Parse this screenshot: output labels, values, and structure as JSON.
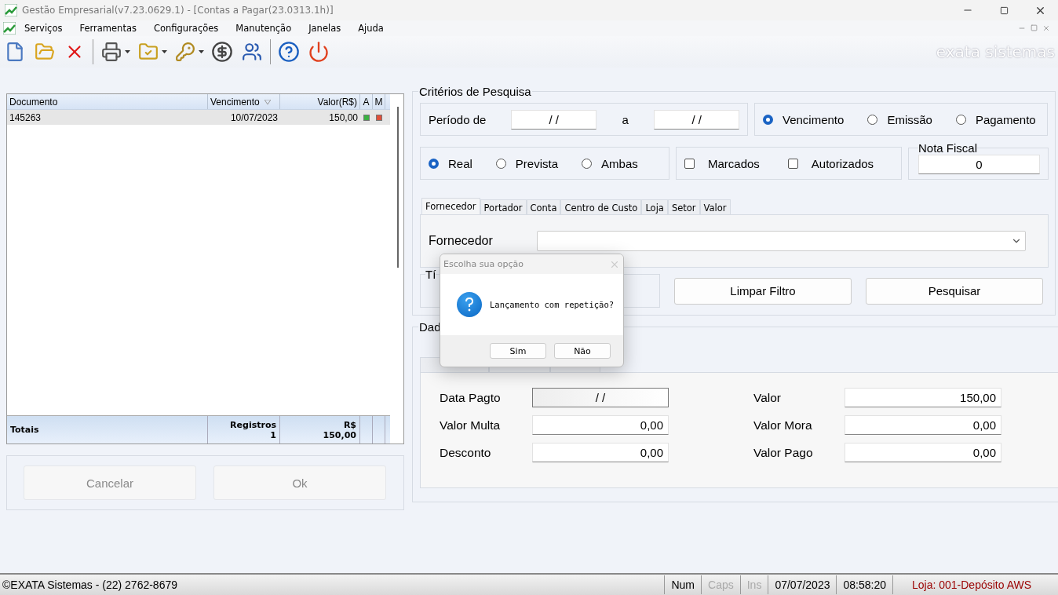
{
  "window": {
    "title": "Gestão Empresarial(v7.23.0629.1) - [Contas a Pagar(23.0313.1h)]"
  },
  "menu": [
    "Serviços",
    "Ferramentas",
    "Configurações",
    "Manutenção",
    "Janelas",
    "Ajuda"
  ],
  "brand": "exata sistemas",
  "grid": {
    "columns": [
      {
        "label": "Documento",
        "sorted": false
      },
      {
        "label": "Vencimento",
        "sorted": true
      },
      {
        "label": "Valor(R$)",
        "sorted": false
      },
      {
        "label": "A",
        "sorted": false
      },
      {
        "label": "M",
        "sorted": false
      }
    ],
    "rows": [
      {
        "documento": "145263",
        "vencimento": "10/07/2023",
        "valor": "150,00",
        "a": {
          "color": "#3cb043"
        },
        "m": {
          "color": "#e0503a"
        },
        "selected": true
      }
    ],
    "totals": {
      "label": "Totais",
      "count_label": "Registros",
      "count": "1",
      "sum_label": "R$",
      "sum": "150,00"
    }
  },
  "actions": [
    {
      "label": "Cancelar",
      "disabled": true
    },
    {
      "label": "Ok",
      "disabled": true
    }
  ],
  "criteria": {
    "title": "Critérios de Pesquisa",
    "period_label": "Período de",
    "from": "/ /",
    "to_label": "a",
    "to": "/ /",
    "date_types": [
      {
        "label": "Vencimento",
        "selected": true
      },
      {
        "label": "Emissão",
        "selected": false
      },
      {
        "label": "Pagamento",
        "selected": false
      }
    ],
    "launch_types": [
      {
        "label": "Real",
        "selected": true
      },
      {
        "label": "Prevista",
        "selected": false
      },
      {
        "label": "Ambas",
        "selected": false
      }
    ],
    "flags": [
      {
        "label": "Marcados",
        "checked": false
      },
      {
        "label": "Autorizados",
        "checked": false
      }
    ],
    "nota_fiscal": {
      "title": "Nota Fiscal",
      "value": "0"
    },
    "tabs": [
      {
        "label": "Fornecedor",
        "selected": true
      },
      {
        "label": "Portador",
        "selected": false
      },
      {
        "label": "Conta",
        "selected": false
      },
      {
        "label": "Centro de Custo",
        "selected": false
      },
      {
        "label": "Loja",
        "selected": false
      },
      {
        "label": "Setor",
        "selected": false
      },
      {
        "label": "Valor",
        "selected": false
      }
    ],
    "filter_label": "Fornecedor",
    "type_group": {
      "title": "Tí"
    },
    "buttons": [
      "Limpar Filtro",
      "Pesquisar"
    ]
  },
  "details": {
    "title": "Dad",
    "left": [
      {
        "label": "Data Pagto",
        "value": "/ /",
        "focused": true
      },
      {
        "label": "Valor Multa",
        "value": "0,00",
        "focused": false
      },
      {
        "label": "Desconto",
        "value": "0,00",
        "focused": false
      }
    ],
    "right": [
      {
        "label": "Valor",
        "value": "150,00",
        "focused": false
      },
      {
        "label": "Valor Mora",
        "value": "0,00",
        "focused": false
      },
      {
        "label": "Valor Pago",
        "value": "0,00",
        "focused": false
      }
    ]
  },
  "status_bar": {
    "copyright": "©EXATA Sistemas - (22) 2762-8679",
    "indicators": [
      {
        "label": "Num",
        "on": true
      },
      {
        "label": "Caps",
        "on": false
      },
      {
        "label": "Ins",
        "on": false
      }
    ],
    "date": "07/07/2023",
    "time": "08:58:20",
    "store": "Loja: 001-Depósito AWS"
  },
  "dialog": {
    "title": "Escolha sua opção",
    "message": "Lançamento com repetição?",
    "buttons": [
      "Sim",
      "Não"
    ]
  }
}
